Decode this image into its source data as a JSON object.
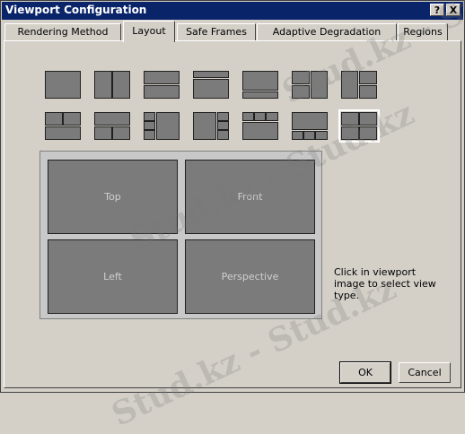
{
  "window": {
    "title": "Viewport Configuration",
    "help_label": "?",
    "close_label": "X"
  },
  "tabs": [
    {
      "label": "Rendering Method",
      "active": false
    },
    {
      "label": "Layout",
      "active": true
    },
    {
      "label": "Safe Frames",
      "active": false
    },
    {
      "label": "Adaptive Degradation",
      "active": false
    },
    {
      "label": "Regions",
      "active": false
    }
  ],
  "layouts": {
    "count": 14,
    "selected_index": 13
  },
  "preview": {
    "viewports": [
      "Top",
      "Front",
      "Left",
      "Perspective"
    ]
  },
  "hint": "Click in viewport image to select view type.",
  "buttons": {
    "ok": "OK",
    "cancel": "Cancel"
  },
  "watermark": [
    "Stud.kz - Stud.kz",
    "Stud.kz - Stud.kz",
    "Stud.kz - Stud.kz"
  ],
  "colors": {
    "titlebar": "#0a246a",
    "viewport": "#7b7b7b",
    "dialog": "#d4d0c8"
  }
}
